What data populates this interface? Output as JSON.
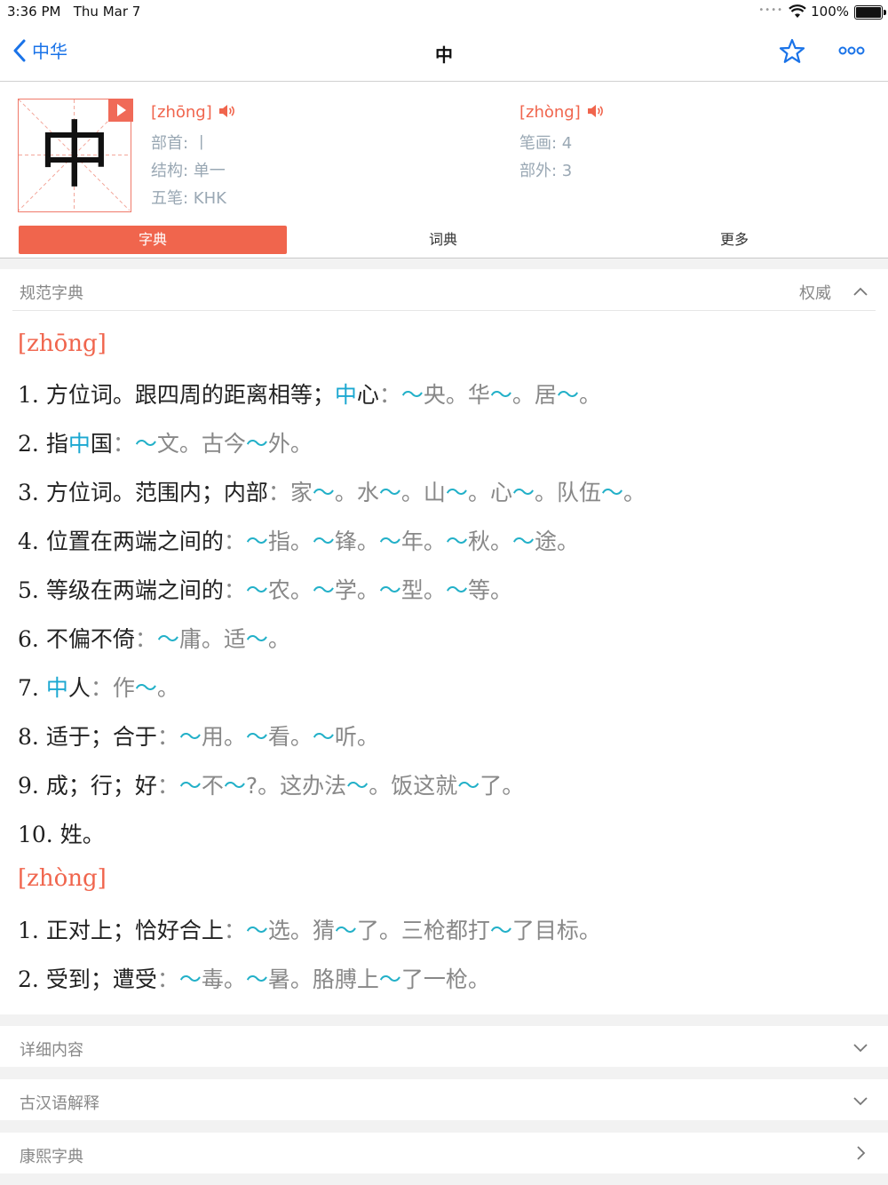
{
  "status": {
    "time": "3:36 PM",
    "date": "Thu Mar 7",
    "battery": "100%"
  },
  "nav": {
    "back_label": "中华",
    "title": "中"
  },
  "header": {
    "glyph": "中",
    "reading1": {
      "pinyin": "[zhōng]",
      "radical_key": "部首",
      "radical_val": "丨",
      "structure_key": "结构",
      "structure_val": "单一",
      "wubi_key": "五笔",
      "wubi_val": "KHK"
    },
    "reading2": {
      "pinyin": "[zhòng]",
      "strokes_key": "笔画",
      "strokes_val": "4",
      "outer_key": "部外",
      "outer_val": "3"
    }
  },
  "tabs": [
    "字典",
    "词典",
    "更多"
  ],
  "section": {
    "title": "规范字典",
    "source": "权威"
  },
  "readings": [
    {
      "pinyin": "[zhōng]",
      "defs": [
        [
          "1. ",
          "方位词。跟四周的距离相等；",
          "中",
          "心",
          "：",
          "～",
          "央。华",
          "～",
          "。居",
          "～",
          "。"
        ],
        [
          "2. ",
          "指",
          "中",
          "国",
          "：",
          "～",
          "文。古今",
          "～",
          "外。"
        ],
        [
          "3. ",
          "方位词。范围内；内部",
          "：",
          "家",
          "～",
          "。水",
          "～",
          "。山",
          "～",
          "。心",
          "～",
          "。队伍",
          "～",
          "。"
        ],
        [
          "4. ",
          "位置在两端之间的",
          "：",
          "～",
          "指。",
          "～",
          "锋。",
          "～",
          "年。",
          "～",
          "秋。",
          "～",
          "途。"
        ],
        [
          "5. ",
          "等级在两端之间的",
          "：",
          "～",
          "农。",
          "～",
          "学。",
          "～",
          "型。",
          "～",
          "等。"
        ],
        [
          "6. ",
          "不偏不倚",
          "：",
          "～",
          "庸。适",
          "～",
          "。"
        ],
        [
          "7. ",
          "中",
          "人",
          "：",
          "作",
          "～",
          "。"
        ],
        [
          "8. ",
          "适于；合于",
          "：",
          "～",
          "用。",
          "～",
          "看。",
          "～",
          "听。"
        ],
        [
          "9. ",
          "成；行；好",
          "：",
          "～",
          "不",
          "～",
          "?。这办法",
          "～",
          "。饭这就",
          "～",
          "了。"
        ],
        [
          "10. ",
          "姓。"
        ]
      ]
    },
    {
      "pinyin": "[zhòng]",
      "defs": [
        [
          "1. ",
          "正对上；恰好合上",
          "：",
          "～",
          "选。猜",
          "～",
          "了。三枪都打",
          "～",
          "了目标。"
        ],
        [
          "2. ",
          "受到；遭受",
          "：",
          "～",
          "毒。",
          "～",
          "暑。胳膊上",
          "～",
          "了一枪。"
        ]
      ]
    }
  ],
  "sections_collapsed": [
    "详细内容",
    "古汉语解释",
    "康熙字典"
  ],
  "colors": {
    "accent": "#f0654d",
    "link": "#1a73e8",
    "tilde": "#22b0c8",
    "highlight": "#1ca8d1"
  }
}
